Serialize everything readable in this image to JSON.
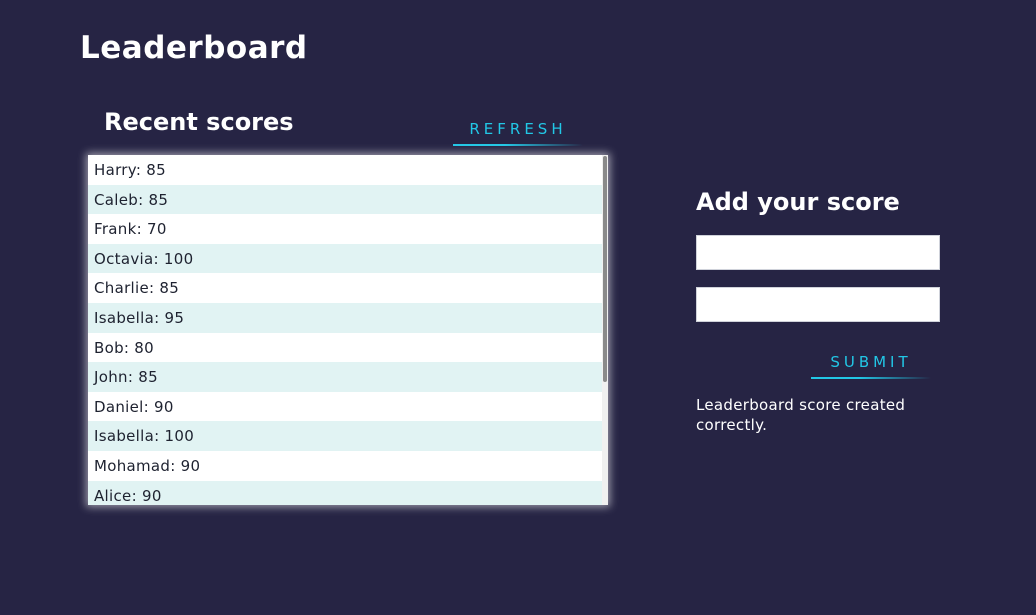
{
  "page": {
    "title": "Leaderboard"
  },
  "recent_scores": {
    "title": "Recent scores",
    "refresh_label": "REFRESH",
    "items": [
      "Harry: 85",
      "Caleb: 85",
      "Frank: 70",
      "Octavia: 100",
      "Charlie: 85",
      "Isabella: 95",
      "Bob: 80",
      "John: 85",
      "Daniel: 90",
      "Isabella: 100",
      "Mohamad: 90",
      "Alice: 90"
    ]
  },
  "add_score": {
    "title": "Add your score",
    "name_value": "",
    "score_value": "",
    "submit_label": "SUBMIT",
    "status_message": "Leaderboard score created correctly."
  },
  "colors": {
    "background": "#262444",
    "accent": "#22c7e6",
    "row_alt": "#e1f3f3",
    "text_dark": "#1e2230"
  }
}
